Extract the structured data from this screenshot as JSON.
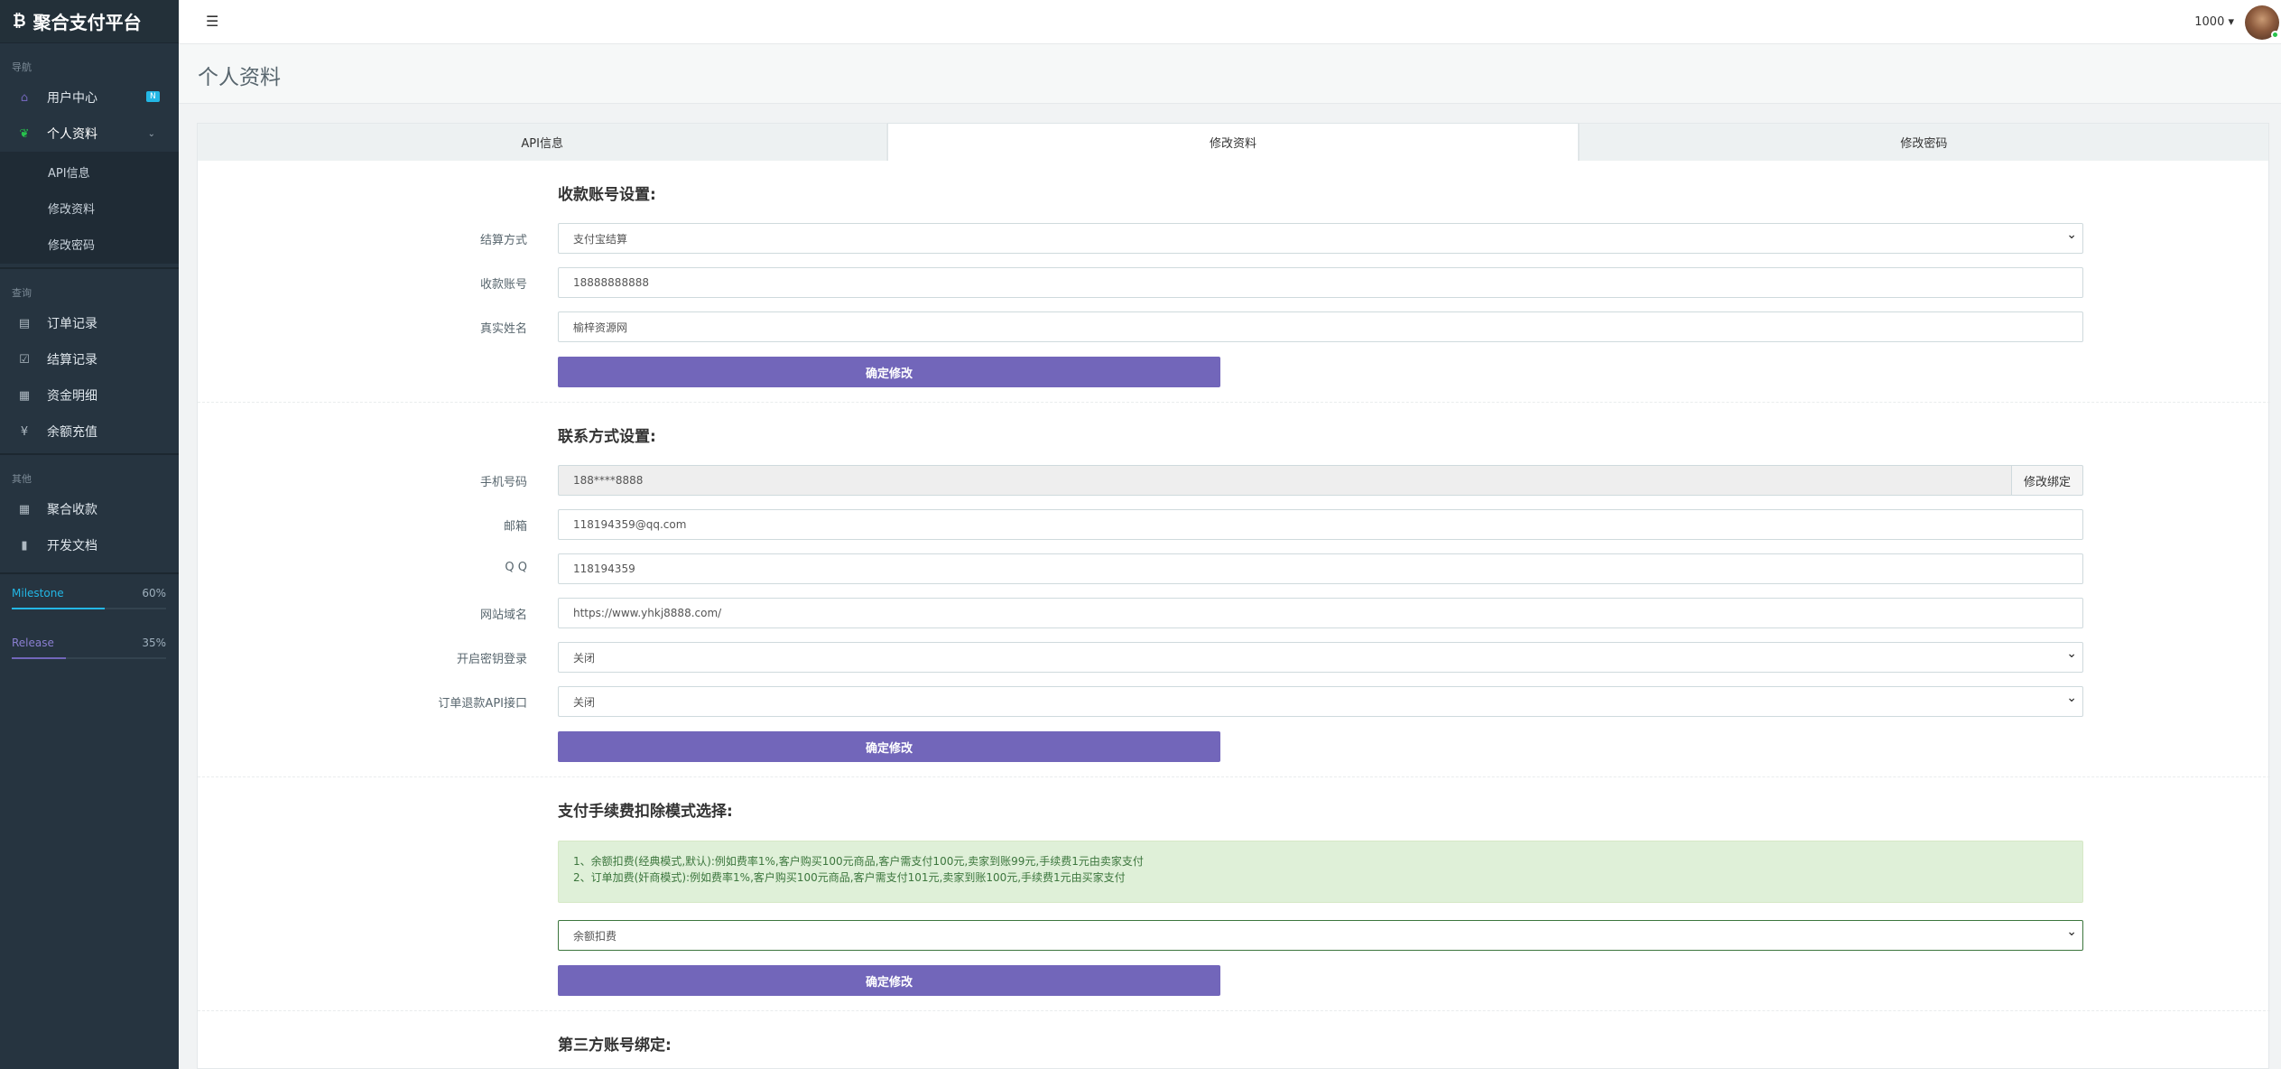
{
  "brand": {
    "logo": "₿",
    "title": "聚合支付平台"
  },
  "sidebar": {
    "sections": {
      "nav": "导航",
      "query": "查询",
      "other": "其他"
    },
    "items": [
      {
        "label": "用户中心",
        "icon": "home-icon",
        "glyph": "⌂",
        "badge": "N"
      },
      {
        "label": "个人资料",
        "icon": "leaf-icon",
        "glyph": "❦"
      },
      {
        "label": "订单记录",
        "icon": "list-icon",
        "glyph": "▤"
      },
      {
        "label": "结算记录",
        "icon": "check-square-icon",
        "glyph": "☑"
      },
      {
        "label": "资金明细",
        "icon": "calendar-icon",
        "glyph": "▦"
      },
      {
        "label": "余额充值",
        "icon": "yen-icon",
        "glyph": "¥"
      },
      {
        "label": "聚合收款",
        "icon": "qrcode-icon",
        "glyph": "▦"
      },
      {
        "label": "开发文档",
        "icon": "book-icon",
        "glyph": "▮"
      }
    ],
    "submenu": [
      "API信息",
      "修改资料",
      "修改密码"
    ],
    "progress": [
      {
        "label": "Milestone",
        "value": "60%",
        "fraction": 0.6,
        "color": "#23b7e5"
      },
      {
        "label": "Release",
        "value": "35%",
        "fraction": 0.35,
        "color": "#7266ba"
      }
    ]
  },
  "topbar": {
    "user": "1000 ▾",
    "toggle": "☰"
  },
  "page": {
    "title": "个人资料"
  },
  "tabs": [
    "API信息",
    "修改资料",
    "修改密码"
  ],
  "payment": {
    "title": "收款账号设置:",
    "settle_label": "结算方式",
    "settle_value": "支付宝结算",
    "account_label": "收款账号",
    "account_value": "18888888888",
    "name_label": "真实姓名",
    "name_value": "榆梓资源网",
    "submit": "确定修改"
  },
  "contact": {
    "title": "联系方式设置:",
    "phone_label": "手机号码",
    "phone_value": "188****8888",
    "phone_btn": "修改绑定",
    "email_label": "邮箱",
    "email_value": "118194359@qq.com",
    "qq_label": "Q Q",
    "qq_value": "118194359",
    "domain_label": "网站域名",
    "domain_value": "https://www.yhkj8888.com/",
    "keylogin_label": "开启密钥登录",
    "keylogin_value": "关闭",
    "refund_label": "订单退款API接口",
    "refund_value": "关闭",
    "submit": "确定修改"
  },
  "fee": {
    "title": "支付手续费扣除模式选择:",
    "line1": "1、余额扣费(经典模式,默认):例如费率1%,客户购买100元商品,客户需支付100元,卖家到账99元,手续费1元由卖家支付",
    "line2": "2、订单加费(奸商模式):例如费率1%,客户购买100元商品,客户需支付101元,卖家到账100元,手续费1元由买家支付",
    "mode_value": "余额扣费",
    "submit": "确定修改"
  },
  "third": {
    "title": "第三方账号绑定:"
  }
}
